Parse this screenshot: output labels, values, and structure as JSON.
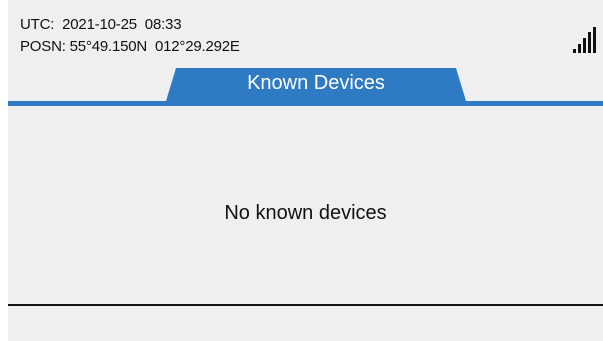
{
  "header": {
    "utc_label": "UTC:",
    "utc_value": "2021-10-25  08:33",
    "posn_label": "POSN:",
    "posn_value": "55°49.150N  012°29.292E",
    "signal_icon": "signal-strength-icon"
  },
  "tab": {
    "title": "Known Devices"
  },
  "main": {
    "empty_message": "No known devices"
  },
  "colors": {
    "accent": "#2e7bc4",
    "background": "#efefef",
    "text": "#111111"
  }
}
